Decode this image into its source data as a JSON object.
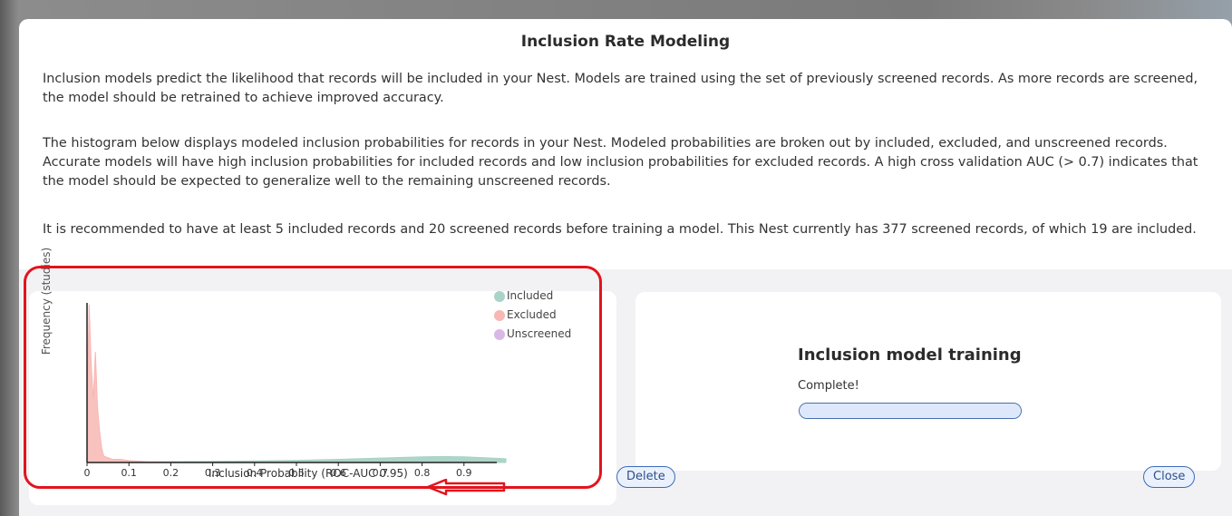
{
  "modal": {
    "title": "Inclusion Rate Modeling",
    "paragraphs": [
      "Inclusion models predict the likelihood that records will be included in your Nest. Models are trained using the set of previously screened records. As more records are screened, the model should be retrained to achieve improved accuracy.",
      "The histogram below displays modeled inclusion probabilities for records in your Nest. Modeled probabilities are broken out by included, excluded, and unscreened records. Accurate models will have high inclusion probabilities for included records and low inclusion probabilities for excluded records. A high cross validation AUC (> 0.7) indicates that the model should be expected to generalize well to the remaining unscreened records.",
      "It is recommended to have at least 5 included records and 20 screened records before training a model. This Nest currently has 377 screened records, of which 19 are included."
    ]
  },
  "chart_data": {
    "type": "area",
    "title": "",
    "xlabel": "Inclusion Probability (ROC-AUC 0.95)",
    "ylabel": "Frequency (studies)",
    "xlim": [
      0,
      1
    ],
    "x_ticks": [
      "0",
      "0.1",
      "0.2",
      "0.3",
      "0.4",
      "0.5",
      "0.6",
      "0.7",
      "0.8",
      "0.9"
    ],
    "legend": "top-right",
    "series": [
      {
        "name": "Included",
        "color": "#a9d3c6",
        "x": [
          0.0,
          0.1,
          0.2,
          0.3,
          0.4,
          0.5,
          0.6,
          0.7,
          0.8,
          0.85,
          0.9,
          0.95,
          1.0
        ],
        "y": [
          0.005,
          0.005,
          0.006,
          0.007,
          0.01,
          0.014,
          0.02,
          0.028,
          0.036,
          0.038,
          0.036,
          0.03,
          0.024
        ]
      },
      {
        "name": "Excluded",
        "color": "#f7b7b3",
        "x": [
          0.0,
          0.005,
          0.01,
          0.015,
          0.02,
          0.025,
          0.03,
          0.035,
          0.04,
          0.05,
          0.06,
          0.08,
          0.1,
          0.15,
          0.2
        ],
        "y": [
          0.3,
          1.0,
          0.62,
          0.4,
          0.7,
          0.35,
          0.2,
          0.09,
          0.04,
          0.03,
          0.02,
          0.02,
          0.012,
          0.005,
          0.0
        ]
      },
      {
        "name": "Unscreened",
        "color": "#d9b8e6",
        "x": [],
        "y": []
      }
    ]
  },
  "training": {
    "title": "Inclusion model training",
    "status": "Complete!",
    "progress": 1.0
  },
  "buttons": {
    "delete": "Delete",
    "close": "Close"
  },
  "colors": {
    "highlight_box": "#e2141c",
    "button_border": "#3e6bb8",
    "button_bg": "#eaf1fc"
  }
}
